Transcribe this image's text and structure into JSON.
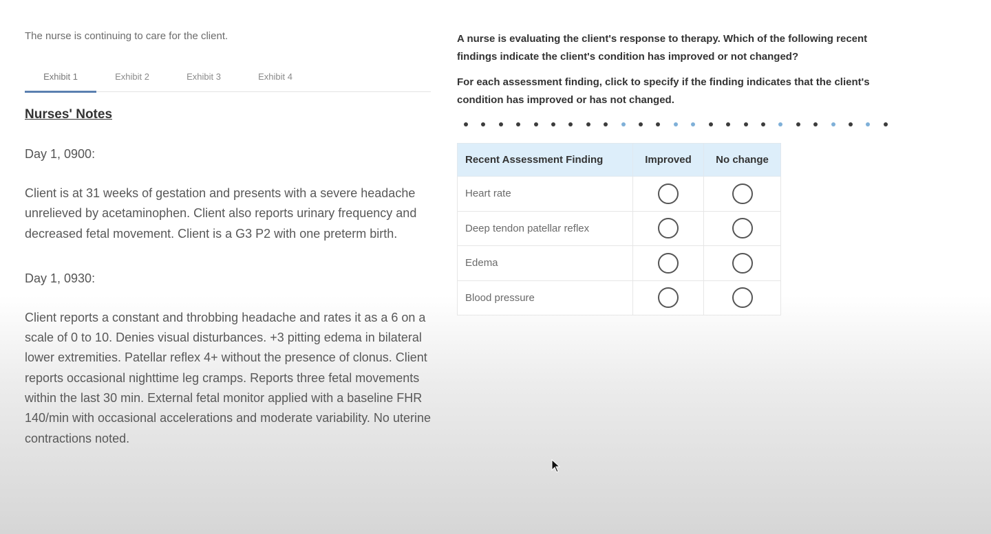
{
  "left": {
    "intro": "The nurse is continuing to care for the client.",
    "tabs": [
      {
        "label": "Exhibit 1",
        "active": true
      },
      {
        "label": "Exhibit 2",
        "active": false
      },
      {
        "label": "Exhibit 3",
        "active": false
      },
      {
        "label": "Exhibit 4",
        "active": false
      }
    ],
    "notes_title": "Nurses' Notes",
    "entries": [
      {
        "time": "Day 1, 0900:",
        "text": "Client is at 31 weeks of gestation and presents with a severe headache unrelieved by acetaminophen. Client also reports urinary frequency and decreased fetal movement. Client is a G3 P2 with one preterm birth."
      },
      {
        "time": "Day 1, 0930:",
        "text": "Client reports a constant and throbbing headache and rates it as a 6 on a scale of 0 to 10. Denies visual disturbances. +3 pitting edema in bilateral lower extremities. Patellar reflex 4+ without the presence of clonus. Client reports occasional nighttime leg cramps. Reports three fetal movements within the last 30 min. External fetal monitor applied with a baseline FHR 140/min with occasional accelerations and moderate variability. No uterine contractions noted."
      }
    ]
  },
  "right": {
    "question": "A nurse is evaluating the client's response to therapy. Which of the following recent findings indicate the client's condition has improved or not changed?",
    "instruction": "For each assessment finding, click to specify if the finding indicates that the client's condition has improved or has not changed.",
    "progress_dots": [
      "dark",
      "dark",
      "dark",
      "dark",
      "dark",
      "dark",
      "dark",
      "dark",
      "dark",
      "light",
      "dark",
      "dark",
      "light",
      "light",
      "dark",
      "dark",
      "dark",
      "dark",
      "light",
      "dark",
      "dark",
      "light",
      "dark",
      "light",
      "dark"
    ],
    "table": {
      "headers": [
        "Recent Assessment Finding",
        "Improved",
        "No change"
      ],
      "rows": [
        {
          "finding": "Heart rate"
        },
        {
          "finding": "Deep tendon patellar reflex"
        },
        {
          "finding": "Edema"
        },
        {
          "finding": "Blood pressure"
        }
      ]
    }
  }
}
